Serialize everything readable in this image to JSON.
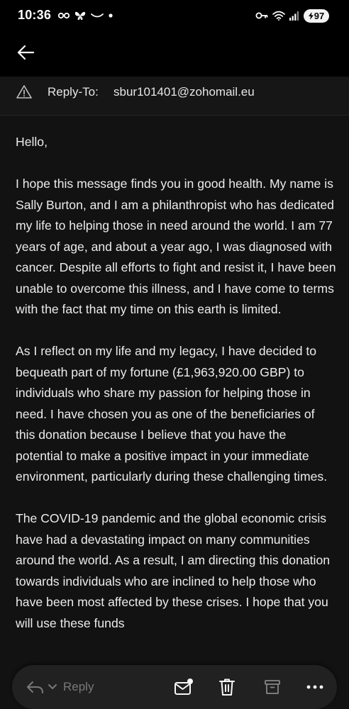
{
  "status_bar": {
    "time": "10:36",
    "battery_level": "97",
    "left_icons": [
      "glasses-icon",
      "butterfly-icon",
      "smile-icon",
      "dot-icon"
    ],
    "right_icons": [
      "key-icon",
      "wifi-icon",
      "signal-icon"
    ]
  },
  "header": {
    "back_icon": "arrow-left-icon"
  },
  "reply_to": {
    "label": "Reply-To:",
    "email": "sbur101401@zohomail.eu",
    "icon": "warning-icon"
  },
  "body": {
    "greeting": "Hello,",
    "paragraphs": [
      "I hope this message finds you in good health. My name is Sally Burton, and I am a philanthropist who has dedicated my life to helping those in need around the world. I am 77 years of age, and about a year ago, I was diagnosed with cancer. Despite all efforts to fight and resist it, I have been unable to overcome this illness, and I have come to terms with the fact that my time on this earth is limited.",
      "As I reflect on my life and my legacy, I have decided to bequeath part of my fortune (£1,963,920.00 GBP) to individuals who share my passion for helping those in need. I have chosen you as one of the beneficiaries of this donation because I believe that you have the potential to make a positive impact in your immediate environment, particularly during these challenging times.",
      "The COVID-19 pandemic and the global economic crisis have had a devastating impact on many communities around the world. As a result, I am directing this donation towards individuals who are inclined to help those who have been most affected by these crises. I hope that you will use these funds"
    ]
  },
  "toolbar": {
    "reply_label": "Reply",
    "icons": [
      "reply-icon",
      "chevron-down-icon",
      "mark-unread-icon",
      "trash-icon",
      "archive-icon",
      "more-icon"
    ]
  },
  "colors": {
    "background": "#121212",
    "toolbar": "#222222",
    "text": "#ececec",
    "muted": "#7d7d7d"
  }
}
